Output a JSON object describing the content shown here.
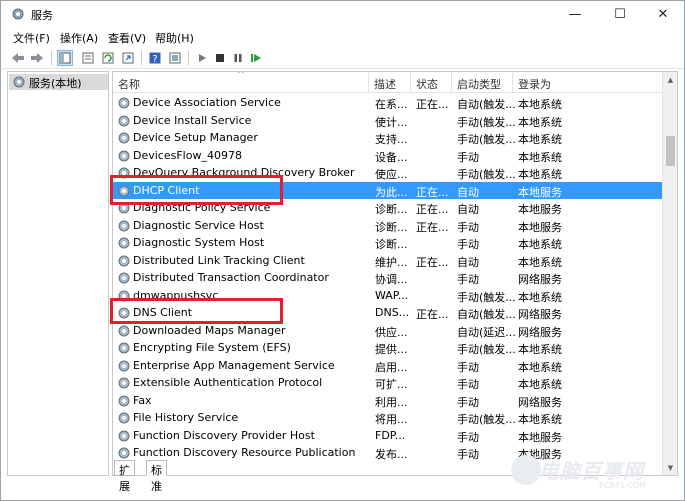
{
  "window": {
    "title": "服务"
  },
  "window_controls": {
    "minimize": "—",
    "maximize": "☐",
    "close": "✕"
  },
  "menu": {
    "file": "文件(F)",
    "action": "操作(A)",
    "view": "查看(V)",
    "help": "帮助(H)"
  },
  "tree": {
    "root_label": "服务(本地)"
  },
  "columns": {
    "name": "名称",
    "desc": "描述",
    "status": "状态",
    "startup": "启动类型",
    "logon": "登录为"
  },
  "rows": [
    {
      "name": "Device Association Service",
      "desc": "在系...",
      "status": "正在...",
      "startup": "自动(触发...",
      "logon": "本地系统"
    },
    {
      "name": "Device Install Service",
      "desc": "使计...",
      "status": "",
      "startup": "手动(触发...",
      "logon": "本地系统"
    },
    {
      "name": "Device Setup Manager",
      "desc": "支持...",
      "status": "",
      "startup": "手动(触发...",
      "logon": "本地系统"
    },
    {
      "name": "DevicesFlow_40978",
      "desc": "设备...",
      "status": "",
      "startup": "手动",
      "logon": "本地系统"
    },
    {
      "name": "DevQuery Background Discovery Broker",
      "desc": "使应...",
      "status": "",
      "startup": "手动(触发...",
      "logon": "本地系统"
    },
    {
      "name": "DHCP Client",
      "desc": "为此...",
      "status": "正在...",
      "startup": "自动",
      "logon": "本地服务"
    },
    {
      "name": "Diagnostic Policy Service",
      "desc": "诊断...",
      "status": "正在...",
      "startup": "自动",
      "logon": "本地服务"
    },
    {
      "name": "Diagnostic Service Host",
      "desc": "诊断...",
      "status": "正在...",
      "startup": "手动",
      "logon": "本地服务"
    },
    {
      "name": "Diagnostic System Host",
      "desc": "诊断...",
      "status": "",
      "startup": "手动",
      "logon": "本地系统"
    },
    {
      "name": "Distributed Link Tracking Client",
      "desc": "维护...",
      "status": "正在...",
      "startup": "自动",
      "logon": "本地系统"
    },
    {
      "name": "Distributed Transaction Coordinator",
      "desc": "协调...",
      "status": "",
      "startup": "手动",
      "logon": "网络服务"
    },
    {
      "name": "dmwappushsvc",
      "desc": "WAP...",
      "status": "",
      "startup": "手动(触发...",
      "logon": "本地系统"
    },
    {
      "name": "DNS Client",
      "desc": "DNS...",
      "status": "正在...",
      "startup": "自动(触发...",
      "logon": "网络服务"
    },
    {
      "name": "Downloaded Maps Manager",
      "desc": "供应...",
      "status": "",
      "startup": "自动(延迟...",
      "logon": "网络服务"
    },
    {
      "name": "Encrypting File System (EFS)",
      "desc": "提供...",
      "status": "",
      "startup": "手动(触发...",
      "logon": "本地系统"
    },
    {
      "name": "Enterprise App Management Service",
      "desc": "启用...",
      "status": "",
      "startup": "手动",
      "logon": "本地系统"
    },
    {
      "name": "Extensible Authentication Protocol",
      "desc": "可扩...",
      "status": "",
      "startup": "手动",
      "logon": "本地系统"
    },
    {
      "name": "Fax",
      "desc": "利用...",
      "status": "",
      "startup": "手动",
      "logon": "网络服务"
    },
    {
      "name": "File History Service",
      "desc": "将用...",
      "status": "",
      "startup": "手动(触发...",
      "logon": "本地系统"
    },
    {
      "name": "Function Discovery Provider Host",
      "desc": "FDP...",
      "status": "",
      "startup": "手动",
      "logon": "本地服务"
    },
    {
      "name": "Function Discovery Resource Publication",
      "desc": "发布...",
      "status": "",
      "startup": "手动",
      "logon": "本地服务"
    }
  ],
  "selected_row": "DHCP Client",
  "highlighted_rows": [
    "DHCP Client",
    "DNS Client"
  ],
  "tabs": {
    "extended": "扩展",
    "standard": "标准"
  },
  "watermark": {
    "text": "电脑百事网",
    "sub": "PC841.COM"
  },
  "colors": {
    "selection": "#3399ff",
    "highlight_box": "#e0202c"
  },
  "icons": [
    "services-icon",
    "back-icon",
    "forward-icon",
    "console-tree-icon",
    "properties-icon",
    "refresh-icon",
    "export-icon",
    "help-icon",
    "view-icon",
    "start-icon",
    "stop-icon",
    "pause-icon",
    "restart-icon",
    "gear-icon"
  ]
}
